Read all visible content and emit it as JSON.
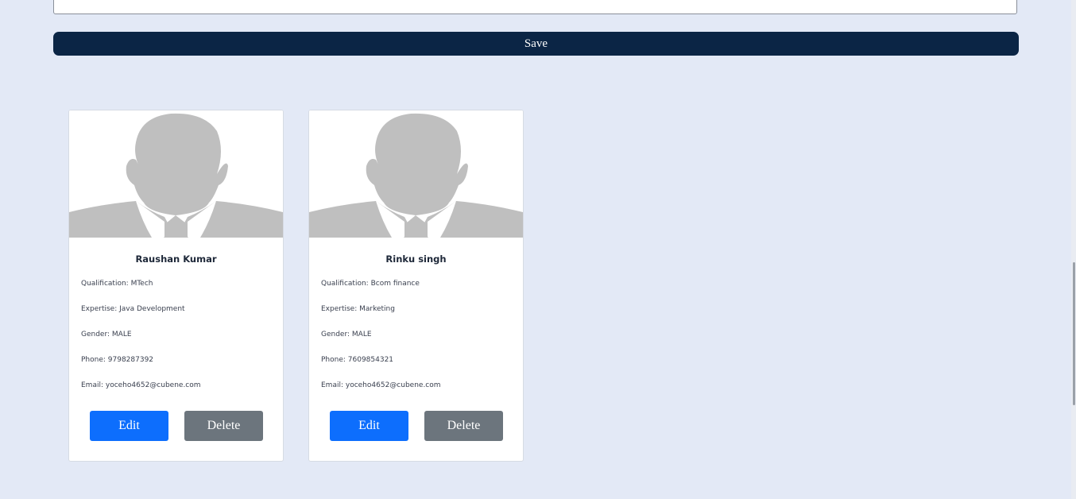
{
  "form": {
    "save_label": "Save"
  },
  "icons": {
    "avatar": "person-silhouette-icon"
  },
  "colors": {
    "page_background": "#e3e9f6",
    "save_button": "#0b2545",
    "edit_button": "#0d6efd",
    "delete_button": "#6c757d",
    "avatar_silhouette": "#bfbfbf"
  },
  "cards": [
    {
      "name": "Raushan Kumar",
      "qualification": "Qualification: MTech",
      "expertise": "Expertise: Java Development",
      "gender": "Gender: MALE",
      "phone": "Phone: 9798287392",
      "email": "Email: yoceho4652@cubene.com",
      "edit_label": "Edit",
      "delete_label": "Delete"
    },
    {
      "name": "Rinku singh",
      "qualification": "Qualification: Bcom finance",
      "expertise": "Expertise: Marketing",
      "gender": "Gender: MALE",
      "phone": "Phone: 7609854321",
      "email": "Email: yoceho4652@cubene.com",
      "edit_label": "Edit",
      "delete_label": "Delete"
    }
  ]
}
